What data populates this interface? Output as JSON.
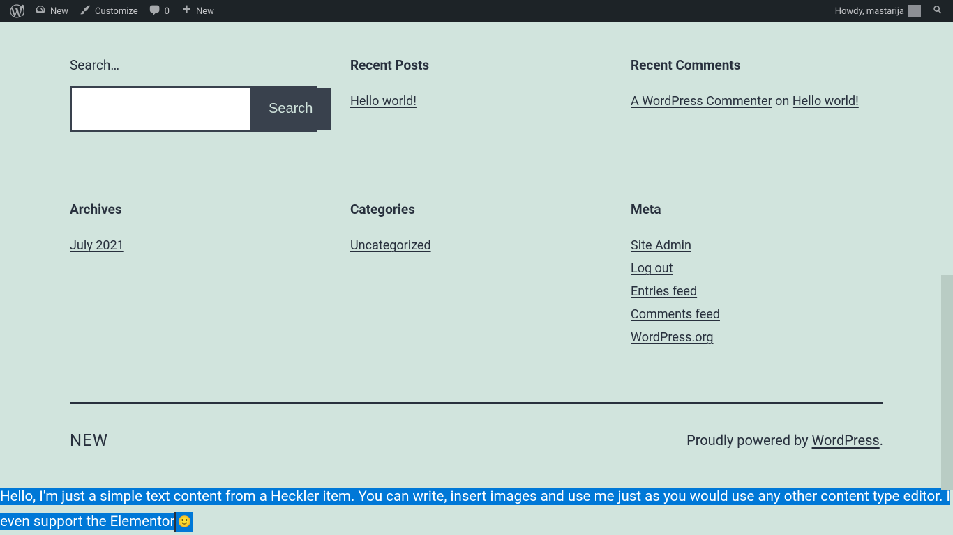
{
  "adminbar": {
    "site_name": "New",
    "customize": "Customize",
    "comments_count": "0",
    "new": "New",
    "howdy": "Howdy, mastarija"
  },
  "search": {
    "label": "Search…",
    "button": "Search"
  },
  "recent_posts": {
    "title": "Recent Posts",
    "items": [
      "Hello world!"
    ]
  },
  "recent_comments": {
    "title": "Recent Comments",
    "author": "A WordPress Commenter",
    "on": " on ",
    "post": "Hello world!"
  },
  "archives": {
    "title": "Archives",
    "items": [
      "July 2021"
    ]
  },
  "categories": {
    "title": "Categories",
    "items": [
      "Uncategorized"
    ]
  },
  "meta": {
    "title": "Meta",
    "items": [
      "Site Admin",
      "Log out",
      "Entries feed",
      "Comments feed",
      "WordPress.org"
    ]
  },
  "footer": {
    "site": "NEW",
    "powered_prefix": "Proudly powered by ",
    "powered_link": "WordPress",
    "powered_suffix": "."
  },
  "heckler": {
    "line1": "Hello, I'm just a simple text content from a Heckler item. You can write, insert images and use me just as you would use any other content type editor. I",
    "line2a": "even support the Elementor",
    "emoji": "🙂"
  }
}
